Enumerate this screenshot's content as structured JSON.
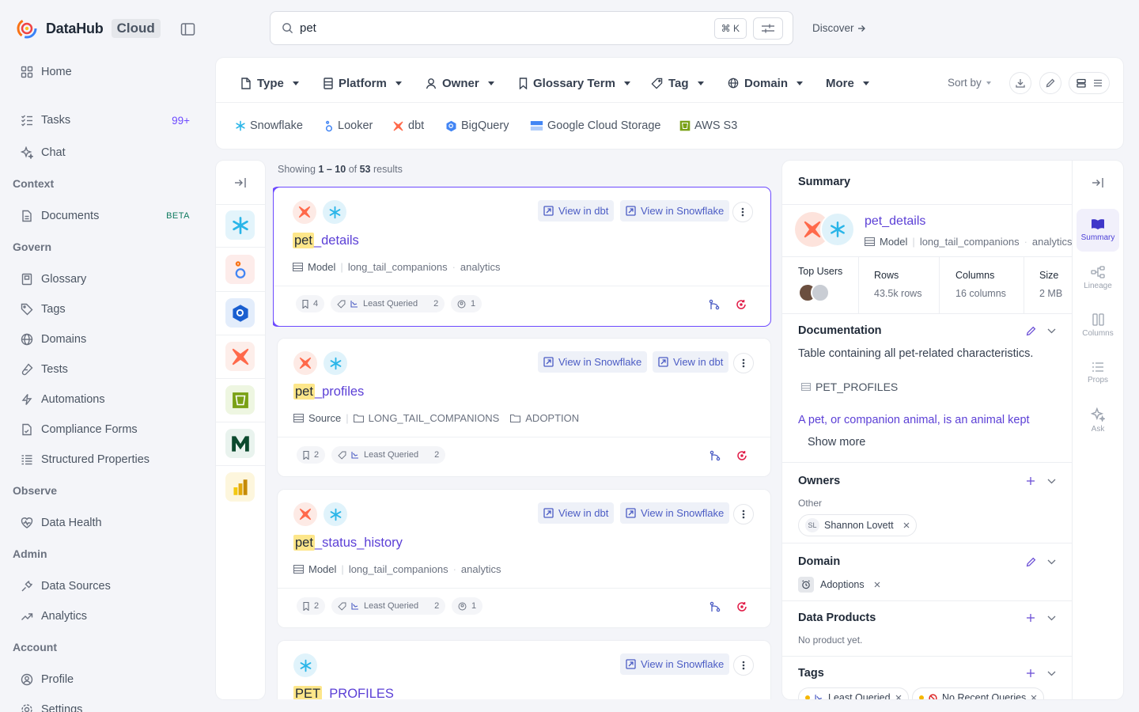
{
  "brand": {
    "name": "DataHub",
    "cloud": "Cloud"
  },
  "sidebar": {
    "home": "Home",
    "tasks": "Tasks",
    "tasks_badge": "99+",
    "chat": "Chat",
    "sec_context": "Context",
    "documents": "Documents",
    "documents_badge": "BETA",
    "sec_govern": "Govern",
    "glossary": "Glossary",
    "tags": "Tags",
    "domains": "Domains",
    "tests": "Tests",
    "automations": "Automations",
    "compliance": "Compliance Forms",
    "structured": "Structured Properties",
    "sec_observe": "Observe",
    "data_health": "Data Health",
    "sec_admin": "Admin",
    "data_sources": "Data Sources",
    "analytics": "Analytics",
    "sec_account": "Account",
    "profile": "Profile",
    "settings": "Settings"
  },
  "search": {
    "value": "pet",
    "shortcut": "⌘ K"
  },
  "discover": "Discover",
  "filters": {
    "type": "Type",
    "platform": "Platform",
    "owner": "Owner",
    "glossary_term": "Glossary Term",
    "tag": "Tag",
    "domain": "Domain",
    "more": "More",
    "sort_by": "Sort by"
  },
  "quick_filters": [
    "Snowflake",
    "Looker",
    "dbt",
    "BigQuery",
    "Google Cloud Storage",
    "AWS S3"
  ],
  "results": {
    "showing_prefix": "Showing",
    "range": "1 – 10",
    "of": "of",
    "total": "53",
    "suffix": "results",
    "cards": [
      {
        "highlight": "pet",
        "rest": "_details",
        "btn1": "View in dbt",
        "btn2": "View in Snowflake",
        "type": "Model",
        "path1": "long_tail_companions",
        "path2": "analytics",
        "bookmarks": "4",
        "tag": "Least Queried",
        "tag_count": "2",
        "users": "1"
      },
      {
        "highlight": "pet",
        "rest": "_profiles",
        "btn1": "View in Snowflake",
        "btn2": "View in dbt",
        "type": "Source",
        "path1": "LONG_TAIL_COMPANIONS",
        "path2": "ADOPTION",
        "bookmarks": "2",
        "tag": "Least Queried",
        "tag_count": "2"
      },
      {
        "highlight": "pet",
        "rest": "_status_history",
        "btn1": "View in dbt",
        "btn2": "View in Snowflake",
        "type": "Model",
        "path1": "long_tail_companions",
        "path2": "analytics",
        "bookmarks": "2",
        "tag": "Least Queried",
        "tag_count": "2",
        "users": "1"
      },
      {
        "highlight": "PET",
        "rest": "_PROFILES",
        "btn1": "View in Snowflake"
      }
    ]
  },
  "panel": {
    "title": "Summary",
    "entity_name": "pet_details",
    "entity_type": "Model",
    "entity_path1": "long_tail_companions",
    "entity_path2": "analytics",
    "top_users": "Top Users",
    "rows_label": "Rows",
    "rows_value": "43.5k rows",
    "columns_label": "Columns",
    "columns_value": "16 columns",
    "size_label": "Size",
    "size_value": "2 MB",
    "documentation": "Documentation",
    "doc_text": "Table containing all pet-related characteristics.",
    "doc_table": "PET_PROFILES",
    "doc_link": "A pet, or companion animal, is an animal kept",
    "show_more": "Show more",
    "owners": "Owners",
    "owners_other": "Other",
    "owner_initials": "SL",
    "owner_name": "Shannon Lovett",
    "domain": "Domain",
    "domain_value": "Adoptions",
    "data_products": "Data Products",
    "no_product": "No product yet.",
    "tags": "Tags",
    "tag1": "Least Queried",
    "tag2": "No Recent Queries"
  },
  "rtabs": {
    "summary": "Summary",
    "lineage": "Lineage",
    "columns": "Columns",
    "props": "Props",
    "ask": "Ask"
  },
  "colors": {
    "accent": "#6d4aff",
    "link": "#5b3fd6",
    "highlight": "#fde68a"
  }
}
